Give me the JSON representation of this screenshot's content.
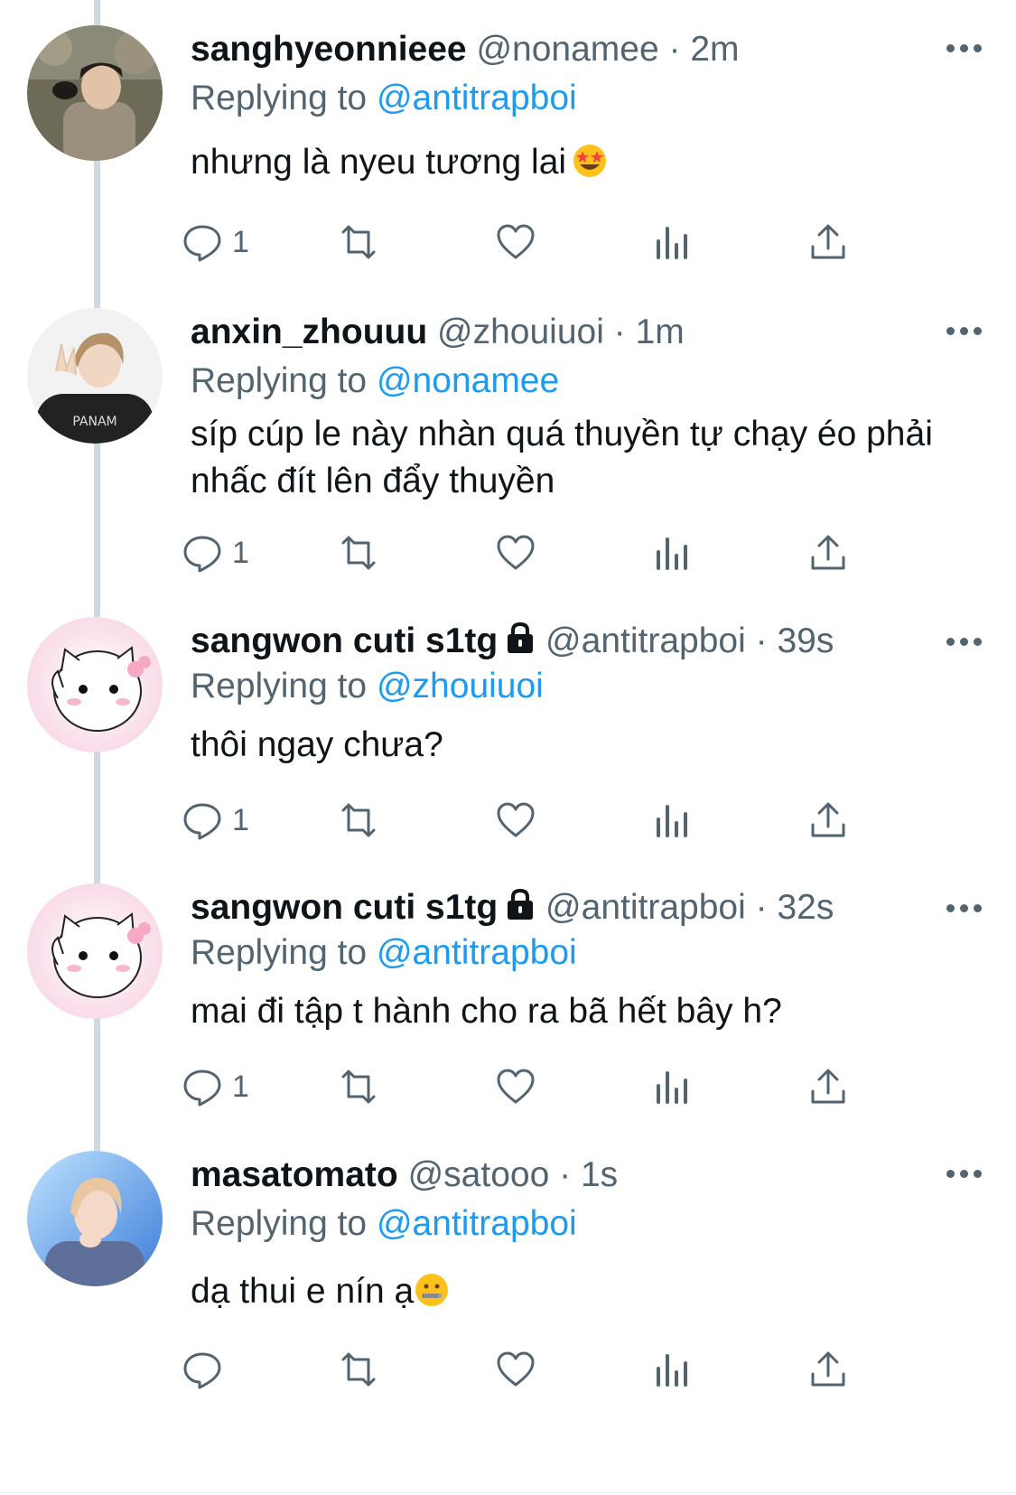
{
  "colors": {
    "link": "#1d9bf0",
    "secondary": "#536471",
    "text": "#0f1419",
    "thread_line": "#cfd9de"
  },
  "tweets": [
    {
      "name": "sanghyeonnieee",
      "handle": "@nonamee",
      "sep": "·",
      "time": "2m",
      "locked": false,
      "replying_label": "Replying to",
      "replying_to": "@antitrapboi",
      "text": "nhưng là nyeu tương lai",
      "emoji": "star-struck-emoji",
      "reply_count": "1",
      "avatar": "photo-young-man-outdoors"
    },
    {
      "name": "anxin_zhouuu",
      "handle": "@zhouiuoi",
      "sep": "·",
      "time": "1m",
      "locked": false,
      "replying_label": "Replying to",
      "replying_to": "@nonamee",
      "text": "síp cúp le này nhàn quá thuyền tự chạy éo phải nhấc đít lên đẩy thuyền",
      "reply_count": "1",
      "avatar": "photo-man-peace-sign"
    },
    {
      "name": "sangwon cuti s1tg",
      "handle": "@antitrapboi",
      "sep": "·",
      "time": "39s",
      "locked": true,
      "replying_label": "Replying to",
      "replying_to": "@zhouiuoi",
      "text": "thôi ngay chưa?",
      "reply_count": "1",
      "avatar": "white-kitty-cartoon"
    },
    {
      "name": "sangwon cuti s1tg",
      "handle": "@antitrapboi",
      "sep": "·",
      "time": "32s",
      "locked": true,
      "replying_label": "Replying to",
      "replying_to": "@antitrapboi",
      "text": "mai đi tập t hành cho ra bã hết bây h?",
      "reply_count": "1",
      "avatar": "white-kitty-cartoon"
    },
    {
      "name": "masatomato",
      "handle": "@satooo",
      "sep": "·",
      "time": "1s",
      "locked": false,
      "replying_label": "Replying to",
      "replying_to": "@antitrapboi",
      "text": "dạ thui e nín ạ",
      "emoji": "zipper-mouth-emoji",
      "reply_count": "",
      "avatar": "photo-smiling-person-hand-on-chin"
    }
  ]
}
